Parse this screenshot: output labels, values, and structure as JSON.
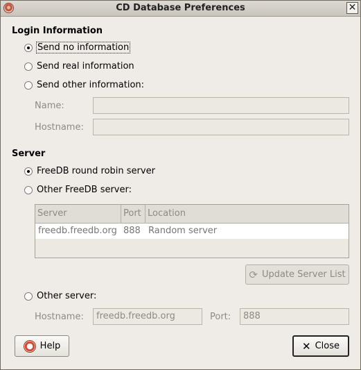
{
  "window": {
    "title": "CD Database Preferences"
  },
  "login": {
    "section_title": "Login Information",
    "options": [
      {
        "label": "Send no information",
        "checked": true
      },
      {
        "label": "Send real information",
        "checked": false
      },
      {
        "label": "Send other information:",
        "checked": false
      }
    ],
    "name_label": "Name:",
    "name_value": "",
    "hostname_label": "Hostname:",
    "hostname_value": ""
  },
  "server": {
    "section_title": "Server",
    "options": [
      {
        "label": "FreeDB round robin server",
        "checked": true
      },
      {
        "label": "Other FreeDB server:",
        "checked": false
      },
      {
        "label": "Other server:",
        "checked": false
      }
    ],
    "table": {
      "columns": [
        "Server",
        "Port",
        "Location"
      ],
      "rows": [
        {
          "server": "freedb.freedb.org",
          "port": "888",
          "location": "Random server"
        }
      ]
    },
    "update_button": "Update Server List",
    "hostname_label": "Hostname:",
    "hostname_value": "freedb.freedb.org",
    "port_label": "Port:",
    "port_value": "888"
  },
  "buttons": {
    "help": "Help",
    "close": "Close"
  },
  "icons": {
    "window": "app-icon",
    "window_close": "close-icon",
    "help": "help-icon",
    "close": "close-x-icon",
    "update": "refresh-icon"
  }
}
